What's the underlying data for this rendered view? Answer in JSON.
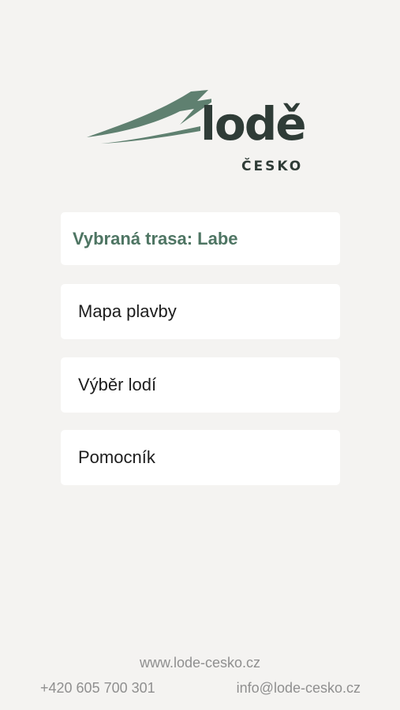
{
  "brand": {
    "logo_word": "lodě",
    "logo_subword": "ČESKO",
    "accent_color": "#4e7563",
    "dark_color": "#2f3c37",
    "logo_icon": "lightning-wave-icon"
  },
  "route": {
    "label": "Vybraná trasa: Labe"
  },
  "menu": {
    "items": [
      {
        "label": "Mapa plavby"
      },
      {
        "label": "Výběr lodí"
      },
      {
        "label": "Pomocník"
      }
    ]
  },
  "footer": {
    "website": "www.lode-cesko.cz",
    "phone": "+420 605 700 301",
    "email": "info@lode-cesko.cz"
  }
}
